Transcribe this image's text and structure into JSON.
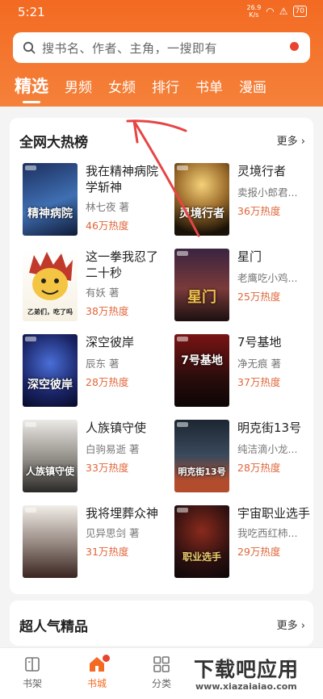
{
  "status": {
    "time": "5:21",
    "net_speed_value": "26.9",
    "net_speed_unit": "K/s",
    "battery": "70"
  },
  "search": {
    "placeholder": "搜书名、作者、主角，一搜即有"
  },
  "tabs": [
    {
      "label": "精选",
      "active": true
    },
    {
      "label": "男频"
    },
    {
      "label": "女频"
    },
    {
      "label": "排行"
    },
    {
      "label": "书单"
    },
    {
      "label": "漫画"
    }
  ],
  "hot_list": {
    "title": "全网大热榜",
    "more": "更多",
    "books": [
      {
        "title": "我在精神病院学斩神",
        "author": "林七夜 著",
        "heat": "46万热度",
        "cover_text": "精神病院"
      },
      {
        "title": "灵境行者",
        "author": "卖报小郎君...",
        "heat": "36万热度",
        "cover_text": "灵境行者"
      },
      {
        "title": "这一拳我忍了二十秒",
        "author": "有妖 著",
        "heat": "38万热度",
        "cover_text": "乙弟们，吃了吗"
      },
      {
        "title": "星门",
        "author": "老鹰吃小鸡...",
        "heat": "25万热度",
        "cover_text": "星门"
      },
      {
        "title": "深空彼岸",
        "author": "辰东 著",
        "heat": "28万热度",
        "cover_text": "深空彼岸"
      },
      {
        "title": "7号基地",
        "author": "净无痕 著",
        "heat": "37万热度",
        "cover_text": "7号基地"
      },
      {
        "title": "人族镇守使",
        "author": "白驹易逝 著",
        "heat": "33万热度",
        "cover_text": "人族镇守使"
      },
      {
        "title": "明克街13号",
        "author": "纯洁滴小龙...",
        "heat": "28万热度",
        "cover_text": "明克街13号"
      },
      {
        "title": "我将埋葬众神",
        "author": "见异思剑 著",
        "heat": "31万热度",
        "cover_text": ""
      },
      {
        "title": "宇宙职业选手",
        "author": "我吃西红柿...",
        "heat": "29万热度",
        "cover_text": "职业选手"
      }
    ]
  },
  "section2": {
    "title": "超人气精品",
    "more": "更多"
  },
  "bottom_nav": [
    {
      "label": "书架",
      "icon": "bookshelf-icon"
    },
    {
      "label": "书城",
      "icon": "home-icon",
      "active": true
    },
    {
      "label": "分类",
      "icon": "category-grid-icon"
    },
    {
      "label": "",
      "icon": "discover-icon"
    },
    {
      "label": "",
      "icon": "profile-icon"
    }
  ],
  "watermark": {
    "main": "下载吧应用",
    "url": "www.xiazaiaiao.com"
  },
  "colors": {
    "accent": "#f36a22",
    "heat": "#e0663a",
    "dot": "#e8442e",
    "annotation": "#e64545"
  }
}
